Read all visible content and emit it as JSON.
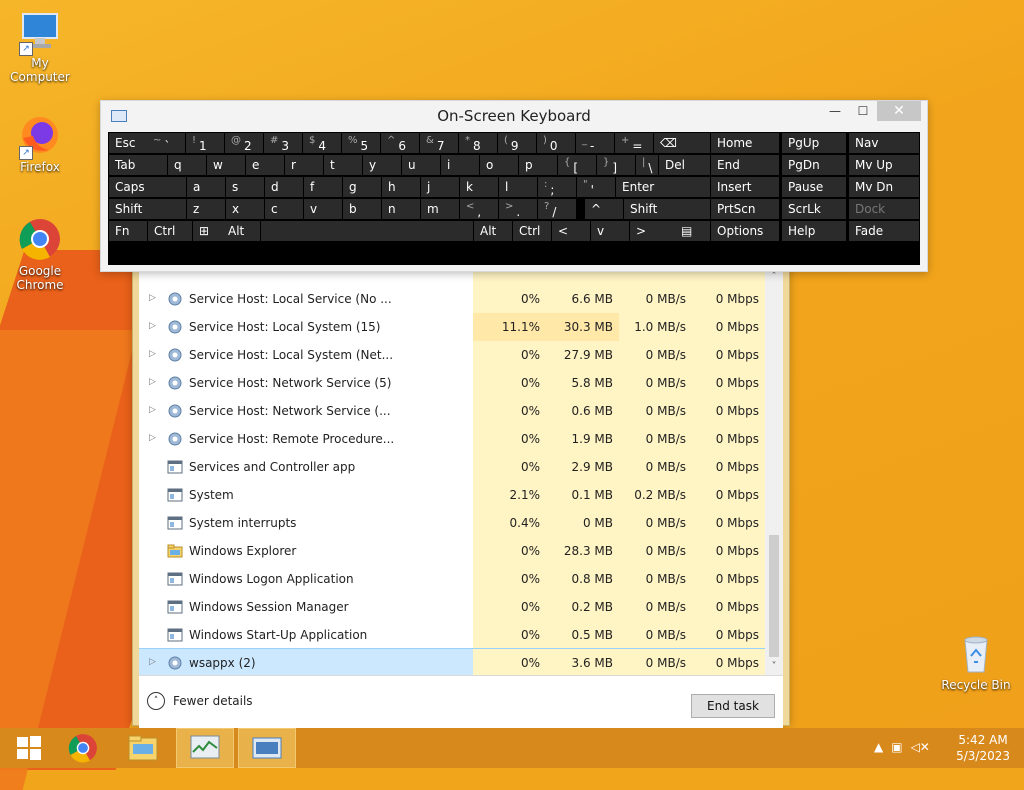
{
  "desktop": {
    "icons": [
      {
        "label": "My Computer"
      },
      {
        "label": "Firefox"
      },
      {
        "label": "Google Chrome"
      },
      {
        "label": "Recycle Bin"
      }
    ]
  },
  "osk": {
    "title": "On-Screen Keyboard",
    "rows": [
      [
        {
          "label": "Esc"
        },
        {
          "shift": "~",
          "main": "`"
        },
        {
          "shift": "!",
          "main": "1"
        },
        {
          "shift": "@",
          "main": "2"
        },
        {
          "shift": "#",
          "main": "3"
        },
        {
          "shift": "$",
          "main": "4"
        },
        {
          "shift": "%",
          "main": "5"
        },
        {
          "shift": "^",
          "main": "6"
        },
        {
          "shift": "&",
          "main": "7"
        },
        {
          "shift": "*",
          "main": "8"
        },
        {
          "shift": "(",
          "main": "9"
        },
        {
          "shift": ")",
          "main": "0"
        },
        {
          "shift": "_",
          "main": "-"
        },
        {
          "shift": "+",
          "main": "="
        },
        {
          "label": "⌫"
        }
      ],
      [
        {
          "label": "Tab"
        },
        {
          "label": "q"
        },
        {
          "label": "w"
        },
        {
          "label": "e"
        },
        {
          "label": "r"
        },
        {
          "label": "t"
        },
        {
          "label": "y"
        },
        {
          "label": "u"
        },
        {
          "label": "i"
        },
        {
          "label": "o"
        },
        {
          "label": "p"
        },
        {
          "shift": "{",
          "main": "["
        },
        {
          "shift": "}",
          "main": "]"
        },
        {
          "shift": "|",
          "main": "\\"
        },
        {
          "label": "Del"
        }
      ],
      [
        {
          "label": "Caps"
        },
        {
          "label": "a"
        },
        {
          "label": "s"
        },
        {
          "label": "d"
        },
        {
          "label": "f"
        },
        {
          "label": "g"
        },
        {
          "label": "h"
        },
        {
          "label": "j"
        },
        {
          "label": "k"
        },
        {
          "label": "l"
        },
        {
          "shift": ":",
          "main": ";"
        },
        {
          "shift": "\"",
          "main": "'"
        },
        {
          "label": "Enter"
        }
      ],
      [
        {
          "label": "Shift"
        },
        {
          "label": "z"
        },
        {
          "label": "x"
        },
        {
          "label": "c"
        },
        {
          "label": "v"
        },
        {
          "label": "b"
        },
        {
          "label": "n"
        },
        {
          "label": "m"
        },
        {
          "shift": "<",
          "main": ","
        },
        {
          "shift": ">",
          "main": "."
        },
        {
          "shift": "?",
          "main": "/"
        },
        {
          "label": "^"
        },
        {
          "label": "Shift"
        }
      ],
      [
        {
          "label": "Fn"
        },
        {
          "label": "Ctrl"
        },
        {
          "label": "⊞"
        },
        {
          "label": "Alt"
        },
        {
          "label": ""
        },
        {
          "label": "Alt"
        },
        {
          "label": "Ctrl"
        },
        {
          "label": "<"
        },
        {
          "label": "v"
        },
        {
          "label": ">"
        },
        {
          "label": "▤"
        }
      ]
    ],
    "nav_keys": [
      [
        "Home",
        "PgUp",
        "Nav"
      ],
      [
        "End",
        "PgDn",
        "Mv Up"
      ],
      [
        "Insert",
        "Pause",
        "Mv Dn"
      ],
      [
        "PrtScn",
        "ScrLk",
        "Dock"
      ],
      [
        "Options",
        "Help",
        "Fade"
      ]
    ]
  },
  "task_manager": {
    "processes": [
      {
        "name": "Service Host: Local Service (No ...",
        "expand": true,
        "icon": "gear",
        "cpu": "0%",
        "mem": "6.6 MB",
        "disk": "0 MB/s",
        "net": "0 Mbps"
      },
      {
        "name": "Service Host: Local System (15)",
        "expand": true,
        "icon": "gear",
        "cpu": "11.1%",
        "mem": "30.3 MB",
        "disk": "1.0 MB/s",
        "net": "0 Mbps",
        "hot": true
      },
      {
        "name": "Service Host: Local System (Net...",
        "expand": true,
        "icon": "gear",
        "cpu": "0%",
        "mem": "27.9 MB",
        "disk": "0 MB/s",
        "net": "0 Mbps"
      },
      {
        "name": "Service Host: Network Service (5)",
        "expand": true,
        "icon": "gear",
        "cpu": "0%",
        "mem": "5.8 MB",
        "disk": "0 MB/s",
        "net": "0 Mbps"
      },
      {
        "name": "Service Host: Network Service (...",
        "expand": true,
        "icon": "gear",
        "cpu": "0%",
        "mem": "0.6 MB",
        "disk": "0 MB/s",
        "net": "0 Mbps"
      },
      {
        "name": "Service Host: Remote Procedure...",
        "expand": true,
        "icon": "gear",
        "cpu": "0%",
        "mem": "1.9 MB",
        "disk": "0 MB/s",
        "net": "0 Mbps"
      },
      {
        "name": "Services and Controller app",
        "expand": false,
        "icon": "window",
        "cpu": "0%",
        "mem": "2.9 MB",
        "disk": "0 MB/s",
        "net": "0 Mbps"
      },
      {
        "name": "System",
        "expand": false,
        "icon": "window",
        "cpu": "2.1%",
        "mem": "0.1 MB",
        "disk": "0.2 MB/s",
        "net": "0 Mbps"
      },
      {
        "name": "System interrupts",
        "expand": false,
        "icon": "window",
        "cpu": "0.4%",
        "mem": "0 MB",
        "disk": "0 MB/s",
        "net": "0 Mbps"
      },
      {
        "name": "Windows Explorer",
        "expand": false,
        "icon": "folder",
        "cpu": "0%",
        "mem": "28.3 MB",
        "disk": "0 MB/s",
        "net": "0 Mbps"
      },
      {
        "name": "Windows Logon Application",
        "expand": false,
        "icon": "window",
        "cpu": "0%",
        "mem": "0.8 MB",
        "disk": "0 MB/s",
        "net": "0 Mbps"
      },
      {
        "name": "Windows Session Manager",
        "expand": false,
        "icon": "window",
        "cpu": "0%",
        "mem": "0.2 MB",
        "disk": "0 MB/s",
        "net": "0 Mbps"
      },
      {
        "name": "Windows Start-Up Application",
        "expand": false,
        "icon": "window",
        "cpu": "0%",
        "mem": "0.5 MB",
        "disk": "0 MB/s",
        "net": "0 Mbps"
      },
      {
        "name": "wsappx (2)",
        "expand": true,
        "icon": "gear",
        "cpu": "0%",
        "mem": "3.6 MB",
        "disk": "0 MB/s",
        "net": "0 Mbps",
        "selected": true
      }
    ],
    "fewer_details_label": "Fewer details",
    "end_task_label": "End task"
  },
  "taskbar": {
    "time": "5:42 AM",
    "date": "5/3/2023"
  }
}
